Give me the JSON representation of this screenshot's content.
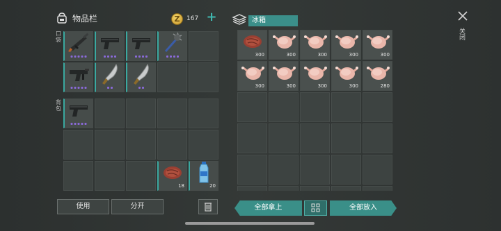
{
  "inventory": {
    "title": "物品栏",
    "coins": "167",
    "pocket_label": "口袋",
    "backpack_label": "背包",
    "pocket_slots": [
      {
        "item": "rifle",
        "dots": 5
      },
      {
        "item": "pistol",
        "dots": 4
      },
      {
        "item": "pistol",
        "dots": 4
      },
      {
        "item": "mace",
        "dots": 4
      },
      {
        "item": "",
        "dots": 0
      },
      {
        "item": "smg",
        "dots": 5
      },
      {
        "item": "machete",
        "dots": 2
      },
      {
        "item": "machete",
        "dots": 2
      },
      {
        "item": "",
        "dots": 0
      },
      {
        "item": "",
        "dots": 0
      }
    ],
    "backpack_slots": [
      {
        "item": "pistol",
        "dots": 5,
        "qty": ""
      },
      {
        "item": "",
        "qty": ""
      },
      {
        "item": "",
        "qty": ""
      },
      {
        "item": "",
        "qty": ""
      },
      {
        "item": "",
        "qty": ""
      },
      {
        "item": "",
        "qty": ""
      },
      {
        "item": "",
        "qty": ""
      },
      {
        "item": "",
        "qty": ""
      },
      {
        "item": "",
        "qty": ""
      },
      {
        "item": "",
        "qty": ""
      },
      {
        "item": "",
        "qty": ""
      },
      {
        "item": "",
        "qty": ""
      },
      {
        "item": "",
        "qty": ""
      },
      {
        "item": "steak",
        "qty": "18"
      },
      {
        "item": "water",
        "qty": "20"
      }
    ]
  },
  "container": {
    "title": "冰箱",
    "slots": [
      {
        "item": "steak",
        "qty": "300"
      },
      {
        "item": "chicken",
        "qty": "300"
      },
      {
        "item": "chicken",
        "qty": "300"
      },
      {
        "item": "chicken",
        "qty": "300"
      },
      {
        "item": "chicken",
        "qty": "300"
      },
      {
        "item": "chicken",
        "qty": "300"
      },
      {
        "item": "chicken",
        "qty": "300"
      },
      {
        "item": "chicken",
        "qty": "300"
      },
      {
        "item": "chicken",
        "qty": "300"
      },
      {
        "item": "chicken",
        "qty": "280"
      },
      {
        "item": "",
        "qty": ""
      },
      {
        "item": "",
        "qty": ""
      },
      {
        "item": "",
        "qty": ""
      },
      {
        "item": "",
        "qty": ""
      },
      {
        "item": "",
        "qty": ""
      },
      {
        "item": "",
        "qty": ""
      },
      {
        "item": "",
        "qty": ""
      },
      {
        "item": "",
        "qty": ""
      },
      {
        "item": "",
        "qty": ""
      },
      {
        "item": "",
        "qty": ""
      },
      {
        "item": "",
        "qty": ""
      },
      {
        "item": "",
        "qty": ""
      },
      {
        "item": "",
        "qty": ""
      },
      {
        "item": "",
        "qty": ""
      },
      {
        "item": "",
        "qty": ""
      },
      {
        "item": "",
        "qty": ""
      },
      {
        "item": "",
        "qty": ""
      },
      {
        "item": "",
        "qty": ""
      },
      {
        "item": "",
        "qty": ""
      },
      {
        "item": "",
        "qty": ""
      }
    ]
  },
  "buttons": {
    "use": "使用",
    "split": "分开",
    "take_all": "全部拿上",
    "put_all": "全部放入",
    "close": "关闭"
  },
  "colors": {
    "accent": "#3aa9a0",
    "rarity": "#8a6ad8"
  }
}
